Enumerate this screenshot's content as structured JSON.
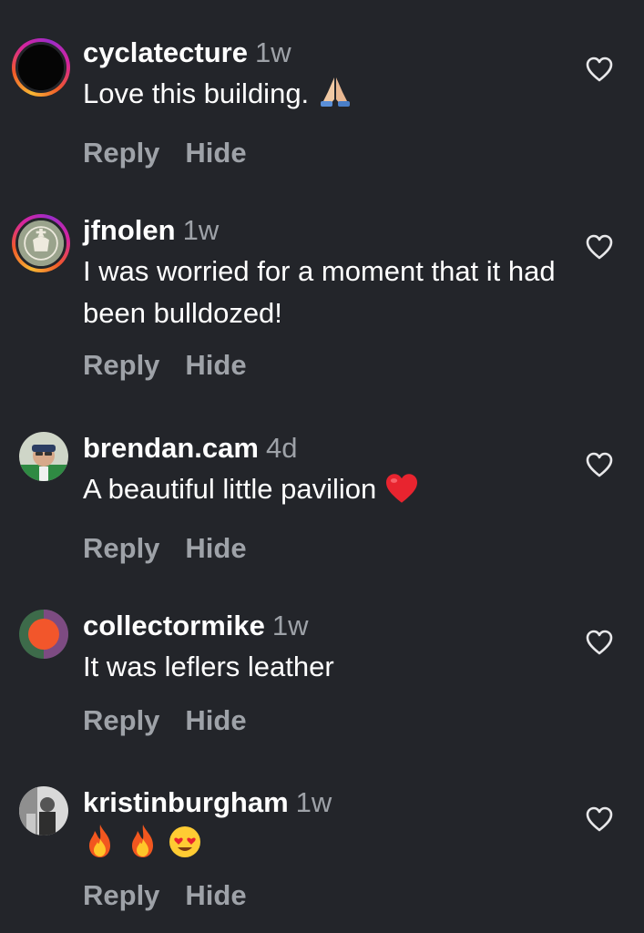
{
  "actions": {
    "reply_label": "Reply",
    "hide_label": "Hide"
  },
  "comments": [
    {
      "username": "cyclatecture",
      "time": "1w",
      "text": "Love this building.",
      "emoji": "folded-hands",
      "avatar": "black-circle-with-story-ring"
    },
    {
      "username": "jfnolen",
      "time": "1w",
      "text": "I was worried for a moment that it had been bulldozed!",
      "avatar": "crest-emblem-with-story-ring"
    },
    {
      "username": "brendan.cam",
      "time": "4d",
      "text": "A beautiful little pavilion",
      "emoji": "red-heart",
      "avatar": "person-photo"
    },
    {
      "username": "collectormike",
      "time": "1w",
      "text": "It was leflers leather",
      "avatar": "orange-circle-graphic"
    },
    {
      "username": "kristinburgham",
      "time": "1w",
      "text": "",
      "emoji": "fire fire heart-eyes",
      "avatar": "grayscale-photo"
    }
  ]
}
